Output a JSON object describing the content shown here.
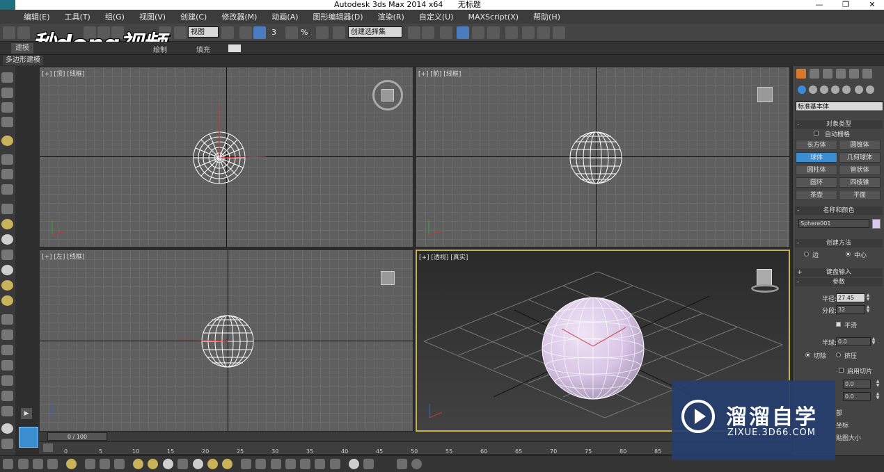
{
  "window": {
    "title": "Autodesk 3ds Max  2014 x64",
    "document": "无标题",
    "controls": [
      "—",
      "❐",
      "✕"
    ]
  },
  "menu": [
    "编辑(E)",
    "工具(T)",
    "组(G)",
    "视图(V)",
    "创建(C)",
    "修改器(M)",
    "动画(A)",
    "图形编辑器(D)",
    "渲染(R)",
    "自定义(U)",
    "MAXScript(X)",
    "帮助(H)"
  ],
  "toolbar": {
    "view_select": "视图",
    "selection_set": "创建选择集",
    "snap_label": "3",
    "percent_label": "%"
  },
  "logo_text": "秒dong视频",
  "ribbon": {
    "tabs": [
      "建模",
      "绘制",
      "填充"
    ],
    "active_tab": "建模",
    "sub_label": "多边形建模"
  },
  "viewports": {
    "top": "[+] [顶] [线框]",
    "front": "[+] [前] [线框]",
    "left": "[+] [左] [线框]",
    "perspective": "[+] [透视] [真实]"
  },
  "command_panel": {
    "category_dropdown": "标准基本体",
    "rollout_object_type": "对象类型",
    "autogrid_label": "自动栅格",
    "object_buttons": [
      "长方体",
      "圆锥体",
      "球体",
      "几何球体",
      "圆柱体",
      "管状体",
      "圆环",
      "四棱锥",
      "茶壶",
      "平面"
    ],
    "active_object": "球体",
    "rollout_name_color": "名称和颜色",
    "object_name": "Sphere001",
    "object_color": "#d8c8f0",
    "rollout_creation_method": "创建方法",
    "creation_edge": "边",
    "creation_center": "中心",
    "rollout_keyboard": "键盘输入",
    "rollout_params": "参数",
    "radius_label": "半径:",
    "radius_value": "27.45",
    "segments_label": "分段:",
    "segments_value": "32",
    "smooth_label": "平滑",
    "hemisphere_label": "半球:",
    "hemisphere_value": "0.0",
    "chop_label": "切除",
    "squash_label": "挤压",
    "slice_label": "启用切片",
    "slice_from_value": "0.0",
    "slice_to_value": "0.0",
    "bottom_labels": [
      "部",
      "坐标",
      "贴图大小"
    ]
  },
  "timeline": {
    "slider": "0 / 100",
    "ticks": [
      "0",
      "5",
      "10",
      "15",
      "20",
      "25",
      "30",
      "35",
      "40",
      "45",
      "50",
      "55",
      "60",
      "65",
      "70",
      "75",
      "80",
      "85"
    ]
  },
  "watermark": {
    "title": "溜溜自学",
    "subtitle": "ZIXUE.3D66.COM"
  },
  "colors": {
    "accent_blue": "#3b8fd0",
    "active_viewport_border": "#c9b24a",
    "sphere_wire": "#ffffff",
    "sphere_shaded": "#d9c6e6"
  }
}
